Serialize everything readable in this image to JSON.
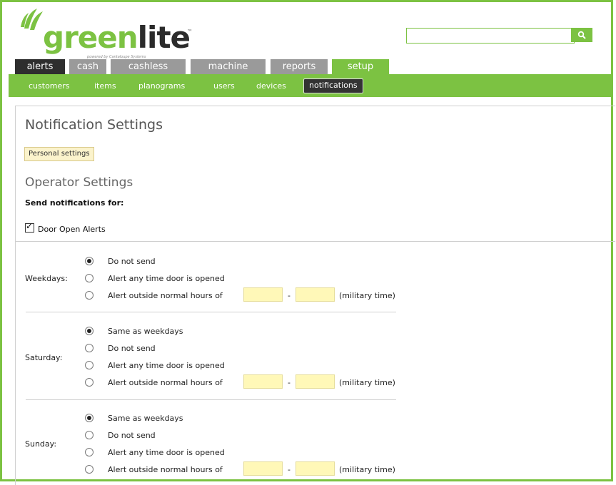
{
  "brand": {
    "name_part1": "gre",
    "name_part2": "en",
    "name_part3": "lite",
    "tm": "™",
    "powered_by": "powered by Cantaloupe Systems",
    "accent": "#7cc242"
  },
  "search": {
    "placeholder": "",
    "icon": "search-icon"
  },
  "tabs": [
    {
      "label": "alerts"
    },
    {
      "label": "cash"
    },
    {
      "label": "cashless"
    },
    {
      "label": "machine"
    },
    {
      "label": "reports"
    },
    {
      "label": "setup",
      "active": true
    }
  ],
  "subnav": [
    {
      "label": "customers"
    },
    {
      "label": "items"
    },
    {
      "label": "planograms"
    },
    {
      "label": "users"
    },
    {
      "label": "devices"
    },
    {
      "label": "notifications",
      "active": true
    }
  ],
  "page": {
    "title": "Notification Settings",
    "personal_button": "Personal settings",
    "section_title": "Operator Settings",
    "send_label": "Send notifications for:",
    "door_alerts_label": "Door Open Alerts",
    "door_alerts_checked": true
  },
  "weekdays": {
    "label": "Weekdays:",
    "options": [
      "Do not send",
      "Alert any time door is opened",
      "Alert outside normal hours of"
    ],
    "selected": 0,
    "dash": "-",
    "suffix": "(military time)"
  },
  "saturday": {
    "label": "Saturday:",
    "options": [
      "Same as weekdays",
      "Do not send",
      "Alert any time door is opened",
      "Alert outside normal hours of"
    ],
    "selected": 0,
    "dash": "-",
    "suffix": "(military time)"
  },
  "sunday": {
    "label": "Sunday:",
    "options": [
      "Same as weekdays",
      "Do not send",
      "Alert any time door is opened",
      "Alert outside normal hours of"
    ],
    "selected": 0,
    "dash": "-",
    "suffix": "(military time)"
  }
}
